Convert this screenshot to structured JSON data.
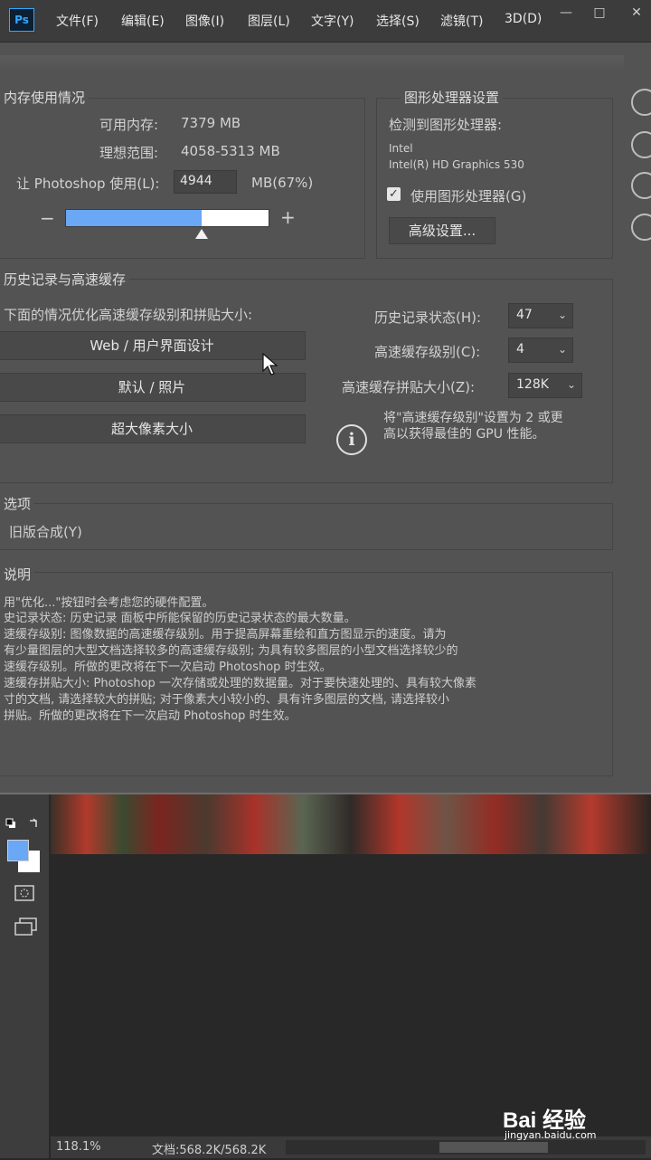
{
  "menubar": {
    "logo": "Ps",
    "items": [
      "文件(F)",
      "编辑(E)",
      "图像(I)",
      "图层(L)",
      "文字(Y)",
      "选择(S)",
      "滤镜(T)",
      "3D(D)"
    ],
    "window_controls": [
      "—",
      "□",
      "✕"
    ]
  },
  "memory": {
    "title": "内存使用情况",
    "available_label": "可用内存:",
    "available_value": "7379 MB",
    "ideal_label": "理想范围:",
    "ideal_value": "4058-5313 MB",
    "use_label": "让 Photoshop 使用(L):",
    "use_value": "4944",
    "use_unit": "MB(67%)",
    "slider_percent": 67,
    "minus": "−",
    "plus": "+"
  },
  "gpu": {
    "title": "图形处理器设置",
    "detected_label": "检测到图形处理器:",
    "vendor": "Intel",
    "model": "Intel(R) HD Graphics 530",
    "use_gpu_label": "使用图形处理器(G)",
    "use_gpu_checked": true,
    "advanced_button": "高级设置..."
  },
  "cache": {
    "title": "历史记录与高速缓存",
    "optimize_label": "下面的情况优化高速缓存级别和拼贴大小:",
    "preset_buttons": [
      "Web / 用户界面设计",
      "默认 / 照片",
      "超大像素大小"
    ],
    "history_label": "历史记录状态(H):",
    "history_value": "47",
    "levels_label": "高速缓存级别(C):",
    "levels_value": "4",
    "tile_label": "高速缓存拼贴大小(Z):",
    "tile_value": "128K",
    "info_line1": "将\"高速缓存级别\"设置为 2 或更",
    "info_line2": "高以获得最佳的 GPU 性能。"
  },
  "options": {
    "title": "选项",
    "legacy_label": "旧版合成(Y)"
  },
  "description": {
    "title": "说明",
    "lines": [
      "用\"优化...\"按钮时会考虑您的硬件配置。",
      "史记录状态: 历史记录 面板中所能保留的历史记录状态的最大数量。",
      "速缓存级别: 图像数据的高速缓存级别。用于提高屏幕重绘和直方图显示的速度。请为",
      "有少量图层的大型文档选择较多的高速缓存级别; 为具有较多图层的小型文档选择较少的",
      "速缓存级别。所做的更改将在下一次启动 Photoshop 时生效。",
      "速缓存拼贴大小: Photoshop 一次存储或处理的数据量。对于要快速处理的、具有较大像素",
      "寸的文档, 请选择较大的拼贴; 对于像素大小较小的、具有许多图层的文档, 请选择较小",
      "拼贴。所做的更改将在下一次启动 Photoshop 时生效。"
    ]
  },
  "status": {
    "zoom": "118.1%",
    "doc_info": "文档:568.2K/568.2K"
  },
  "watermark": {
    "brand": "Bai 经验",
    "url": "jingyan.baidu.com"
  },
  "colors": {
    "accent": "#6aa7f5",
    "panel": "#535353",
    "menubar": "#3c3c3c",
    "workspace": "#282828"
  }
}
